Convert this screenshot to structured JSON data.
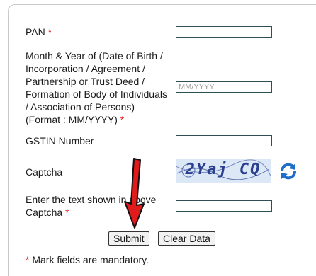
{
  "form": {
    "pan_label": "PAN",
    "dob_label_lines": [
      "Month & Year of (Date of Birth /",
      "Incorporation / Agreement /",
      "Partnership or Trust Deed /",
      "Formation of Body of Individuals",
      "/ Association of Persons)",
      "(Format : MM/YYYY)"
    ],
    "dob_placeholder": "MM/YYYY",
    "gstin_label": "GSTIN Number",
    "captcha_label": "Captcha",
    "captcha_text": "2Yaj CQ",
    "captcha_input_label_lines": [
      "Enter the text shown in above",
      "Captcha"
    ],
    "required_marker": "*"
  },
  "buttons": {
    "submit": "Submit",
    "clear": "Clear Data"
  },
  "footer": {
    "marker": "*",
    "note": " Mark fields are mandatory."
  },
  "colors": {
    "required": "#e0242a",
    "arrow": "#e01b1b",
    "refresh": "#1f6fc9"
  },
  "icons": [
    "refresh-captcha-icon",
    "red-arrow-annotation"
  ]
}
